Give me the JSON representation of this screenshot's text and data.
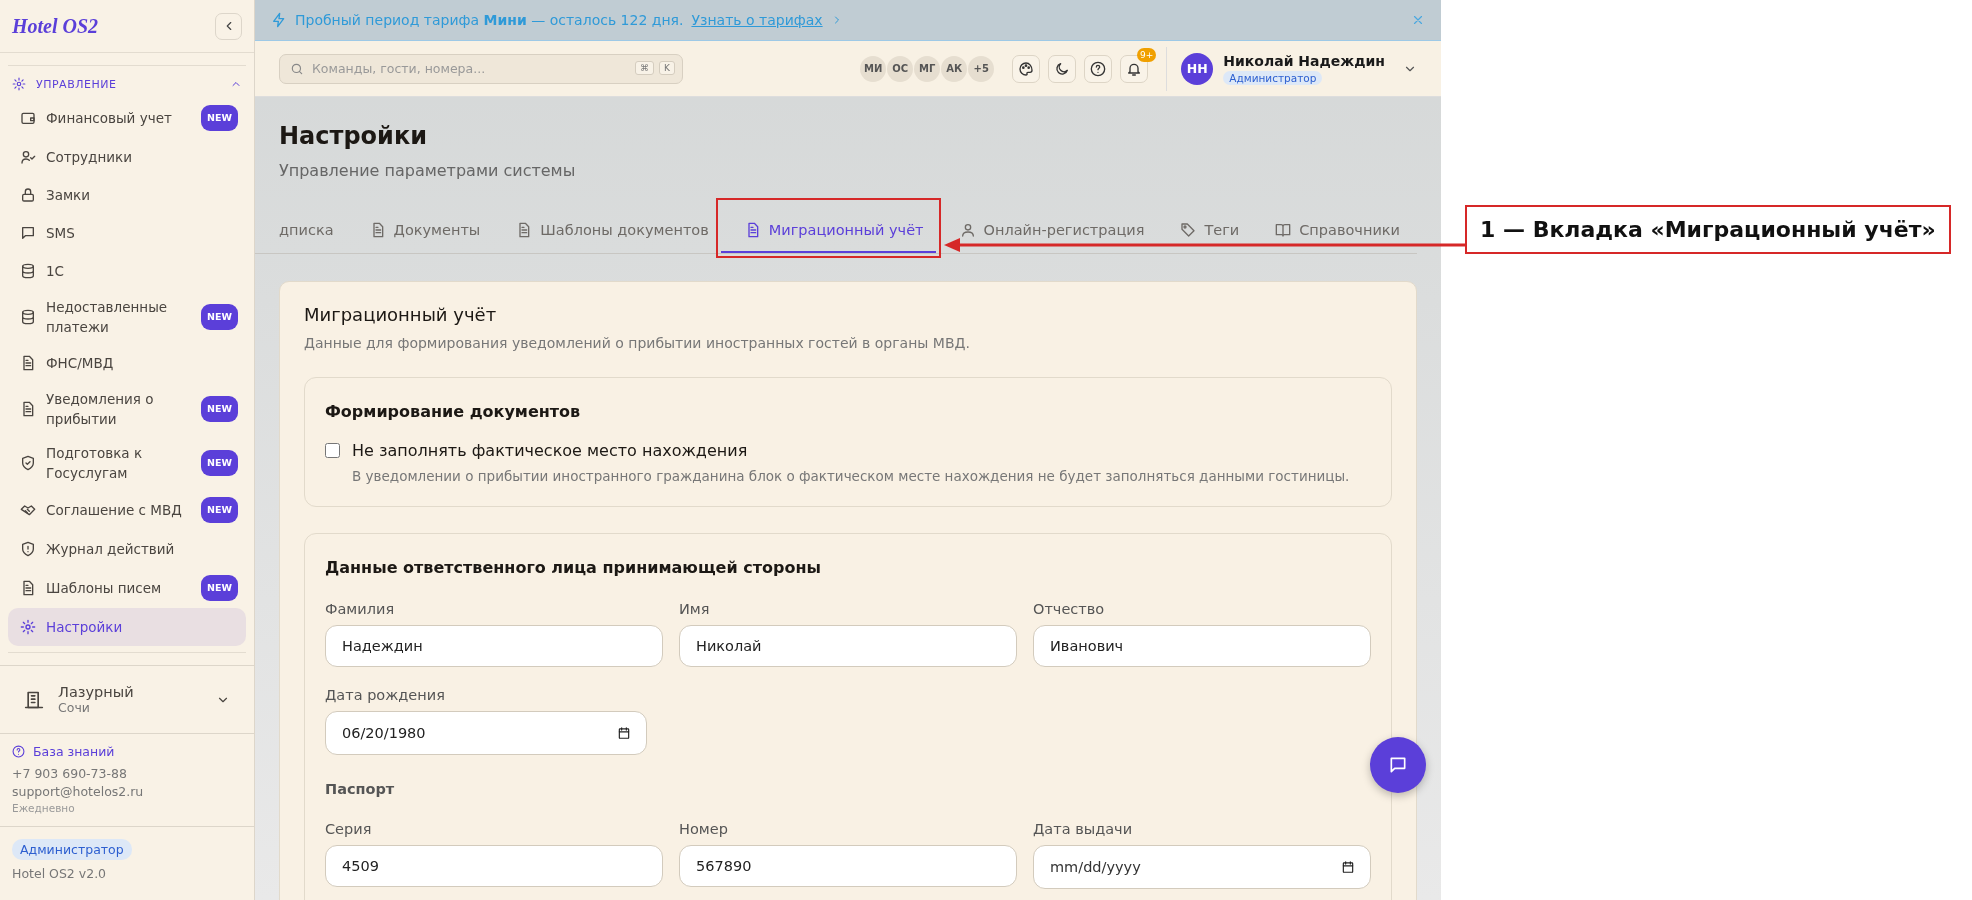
{
  "sidebar": {
    "logo": "Hotel OS2",
    "section": {
      "title": "УПРАВЛЕНИЕ",
      "expanded": true
    },
    "items": [
      {
        "label": "Финансовый учет",
        "badge": "NEW",
        "selected": false
      },
      {
        "label": "Сотрудники",
        "selected": false
      },
      {
        "label": "Замки",
        "selected": false
      },
      {
        "label": "SMS",
        "selected": false
      },
      {
        "label": "1С",
        "selected": false
      },
      {
        "label": "Недоставленные платежи",
        "badge": "NEW",
        "selected": false
      },
      {
        "label": "ФНС/МВД",
        "selected": false
      },
      {
        "label": "Уведомления о прибытии",
        "badge": "NEW",
        "selected": false
      },
      {
        "label": "Подготовка к Госуслугам",
        "badge": "NEW",
        "selected": false
      },
      {
        "label": "Соглашение с МВД",
        "badge": "NEW",
        "selected": false
      },
      {
        "label": "Журнал действий",
        "selected": false
      },
      {
        "label": "Шаблоны писем",
        "badge": "NEW",
        "selected": false
      },
      {
        "label": "Настройки",
        "selected": true
      }
    ],
    "hotel": {
      "name": "Лазурный",
      "city": "Сочи"
    },
    "support": {
      "link": "База знаний",
      "phone": "+7 903 690-73-88",
      "email": "support@hotelos2.ru",
      "hours": "Ежедневно"
    },
    "role": "Администратор",
    "version": "Hotel OS2 v2.0"
  },
  "banner": {
    "text": "Пробный период тарифа **Мини** — осталось 122 дня.",
    "link": "Узнать о тарифах"
  },
  "header": {
    "search": {
      "placeholder": "Команды, гости, номера..."
    },
    "shortcut": [
      "⌘",
      "K"
    ],
    "online_users": [
      "МИ",
      "ОС",
      "МГ",
      "АК",
      "+5"
    ],
    "notifications_badge": "9+",
    "user": {
      "initials": "НН",
      "name": "Николай Надеждин",
      "role": "Администратор"
    }
  },
  "page": {
    "title": "Настройки",
    "subtitle": "Управление параметрами системы"
  },
  "tabs": [
    {
      "label": "дписка",
      "selected": false
    },
    {
      "label": "Документы",
      "selected": false
    },
    {
      "label": "Шаблоны документов",
      "selected": false
    },
    {
      "label": "Миграционный учёт",
      "selected": true
    },
    {
      "label": "Онлайн-регистрация",
      "selected": false
    },
    {
      "label": "Теги",
      "selected": false
    },
    {
      "label": "Справочники",
      "selected": false
    }
  ],
  "migration": {
    "title": "Миграционный учёт",
    "description": "Данные для формирования уведомлений о прибытии иностранных гостей в органы МВД.",
    "documents": {
      "title": "Формирование документов",
      "option": {
        "label": "Не заполнять фактическое место нахождения",
        "hint": "В уведомлении о прибытии иностранного гражданина блок о фактическом месте нахождения не будет заполняться данными гостиницы.",
        "checked": false
      }
    },
    "responsible": {
      "title": "Данные ответственного лица принимающей стороны",
      "fields": [
        {
          "label": "Фамилия",
          "value": "Надеждин"
        },
        {
          "label": "Имя",
          "value": "Николай"
        },
        {
          "label": "Отчество",
          "value": "Иванович"
        }
      ],
      "birth": {
        "label": "Дата рождения",
        "value": "06/20/1980"
      },
      "passport": {
        "title": "Паспорт",
        "fields": [
          {
            "kind": "text",
            "label": "Серия",
            "value": "4509"
          },
          {
            "kind": "text",
            "label": "Номер",
            "value": "567890"
          },
          {
            "kind": "date",
            "label": "Дата выдачи",
            "placeholder": "mm/dd/yyyy"
          }
        ]
      }
    }
  },
  "annotation": {
    "text": "1 — Вкладка «Миграционный учёт»"
  }
}
